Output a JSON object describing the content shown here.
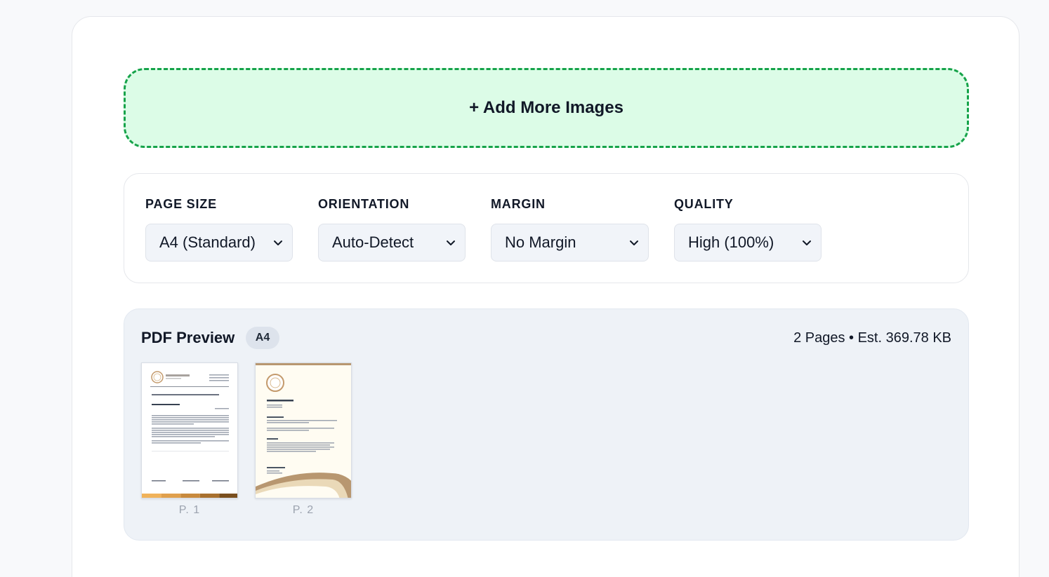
{
  "upload": {
    "label": "+ Add More Images"
  },
  "settings": {
    "page_size": {
      "label": "PAGE SIZE",
      "value": "A4 (Standard)"
    },
    "orientation": {
      "label": "ORIENTATION",
      "value": "Auto-Detect"
    },
    "margin": {
      "label": "MARGIN",
      "value": "No Margin"
    },
    "quality": {
      "label": "QUALITY",
      "value": "High (100%)"
    }
  },
  "preview": {
    "title": "PDF Preview",
    "badge": "A4",
    "info": "2 Pages • Est. 369.78 KB",
    "pages": [
      {
        "label": "P. 1"
      },
      {
        "label": "P. 2"
      }
    ]
  },
  "colors": {
    "dropzone_bg": "#dcfce7",
    "dropzone_border": "#16a34a",
    "preview_bg": "#eef2f7",
    "accent_gold": "#c49a6c"
  }
}
